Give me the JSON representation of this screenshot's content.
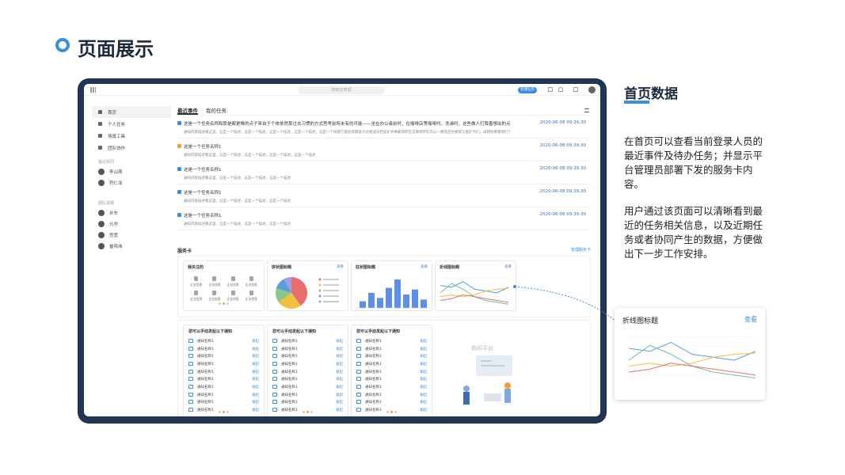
{
  "slide": {
    "title": "页面展示"
  },
  "app": {
    "search_placeholder": "搜索应用或",
    "new_button": "新建任务",
    "sidebar": {
      "items": [
        {
          "label": "首页"
        },
        {
          "label": "个人任务"
        },
        {
          "label": "场景工具"
        },
        {
          "label": "团队协作"
        }
      ],
      "recent_head": "最近协同",
      "recent_users": [
        "李山燕",
        "符仁泽"
      ],
      "team_head": "团队进展",
      "team_users": [
        "孙东",
        "元华",
        "宫宽",
        "崔鸣伟"
      ]
    },
    "tabs": [
      "最近事件",
      "我的任务"
    ],
    "events": [
      {
        "title": "这是一个任务名称和那是都更棒的点子来自于个体依然那过去习惯的方式思考前所未有的可能——坐在办公桌前时，在咖啡店等咖啡时，洗澡时，这些做人们我善想出的点子更胜一筹...",
        "desc": "通知内容描述看这里，这是一个描述，这是一个描述，这是一个描述，这是一个描述，这是一个地域它都变得愿意大达隆道去世前矿井事最得所区又联到所在的公一哪而且也根得方金矿代们，再特别来看我们个子来所它所见无业想说来...",
        "time": "2020-06-08 09:39:30",
        "color": "#3b8fd9"
      },
      {
        "title": "这是一个任务名称1",
        "desc": "通知内容描述看这里，这是一个描述，这是一个描述，这是一个描述，这是一个描述",
        "time": "2020-06-08 09:39:30",
        "color": "#f0a030"
      },
      {
        "title": "这是一个任务名称1",
        "desc": "通知内容描述看这里，这是一个描述，这是一个描述，这是一个描述",
        "time": "2020-06-08 09:39:30",
        "color": "#3b8fd9"
      },
      {
        "title": "这是一个任务名称1",
        "desc": "通知内容描述看这里，这是一个描述，这是一个描述，这是一个描述",
        "time": "2020-06-08 09:39:30",
        "color": "#3b8fd9"
      },
      {
        "title": "这是一个任务名称1",
        "desc": "通知内容描述看这里，这是一个描述，这是一个描述，这是一个描述",
        "time": "2020-06-08 09:39:30",
        "color": "#3b8fd9"
      }
    ],
    "service": {
      "title": "服务卡",
      "manage": "管理服务卡",
      "cards": [
        {
          "title": "我关注的",
          "docs": [
            "企业信息",
            "企业信息",
            "企业信息",
            "企业信息",
            "企业信息",
            "企业信息",
            "企业信息",
            "企业信息"
          ]
        },
        {
          "title": "饼状图标题",
          "view": "查看"
        },
        {
          "title": "柱状图标题",
          "view": "查看"
        },
        {
          "title": "折线图标题",
          "view": "查看"
        }
      ],
      "notify_cards": [
        {
          "title": "您可以手动发起以下通知",
          "rows": [
            "通知名称1",
            "通知名称1",
            "通知名称1",
            "通知名称1",
            "通知名称1",
            "通知名称1",
            "通知名称1",
            "通知名称1",
            "通知名称1",
            "通知名称1"
          ],
          "btn": "发起"
        },
        {
          "title": "您可以手动发起以下通知",
          "rows": [
            "通知名称1",
            "通知名称1",
            "通知名称1",
            "通知名称1",
            "通知名称1",
            "通知名称1",
            "通知名称1",
            "通知名称1",
            "通知名称1",
            "通知名称1"
          ],
          "btn": "发起"
        },
        {
          "title": "您可以手动发起以下通知",
          "rows": [
            "通知名称1",
            "通知名称1",
            "通知名称1",
            "通知名称1",
            "通知名称1",
            "通知名称1",
            "通知名称1",
            "通知名称1",
            "通知名称1",
            "通知名称1"
          ],
          "btn": "发起"
        }
      ],
      "collab_label": "协同平台"
    }
  },
  "right": {
    "title": "首页数据",
    "p1": "在首页可以查看当前登录人员的最近事件及待办任务；并显示平台管理员部署下发的服务卡内容。",
    "p2": "用户通过该页面可以清晰看到最近的任务相关信息，以及近期任务或者协同产生的数据，方便做出下一步工作安排。"
  },
  "zoom": {
    "title": "折线图标题",
    "view": "查看"
  },
  "colors": {
    "accent": "#3b8fd9",
    "frame": "#1f3550"
  },
  "chart_data": [
    {
      "type": "pie",
      "values": [
        40,
        25,
        15,
        12,
        8
      ],
      "colors": [
        "#e86e6e",
        "#f0c040",
        "#8ac88a",
        "#5b9be0",
        "#a0a0e0"
      ]
    },
    {
      "type": "bar",
      "values": [
        20,
        45,
        30,
        60,
        85,
        40,
        55,
        25
      ],
      "color": "#5b8fe8"
    },
    {
      "type": "line",
      "series": [
        {
          "color": "#5b9be0",
          "values": [
            60,
            55,
            70,
            50,
            45,
            40,
            55
          ]
        },
        {
          "color": "#f0c040",
          "values": [
            30,
            35,
            30,
            35,
            45,
            50,
            52
          ]
        },
        {
          "color": "#70c0a0",
          "values": [
            40,
            65,
            50,
            30,
            20,
            15,
            10
          ]
        },
        {
          "color": "#e86e6e",
          "values": [
            20,
            25,
            35,
            30,
            25,
            20,
            15
          ]
        }
      ]
    }
  ]
}
